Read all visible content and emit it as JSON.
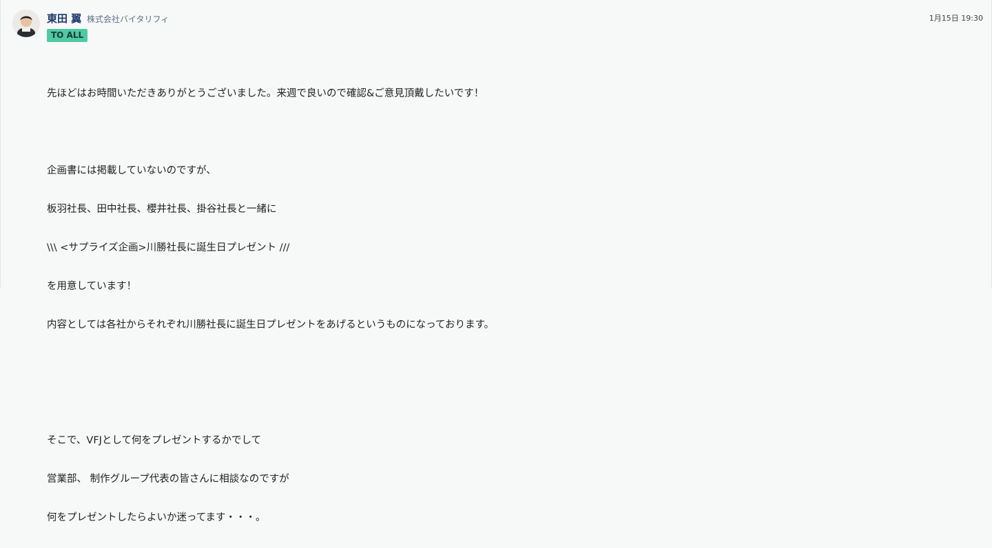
{
  "sender": {
    "name": "東田 翼",
    "organization": "株式会社バイタリフィ",
    "avatar": "user-avatar-photo"
  },
  "to_badge": "TO ALL",
  "timestamp": "1月15日 19:30",
  "body_lines": [
    "先ほどはお時間いただきありがとうございました。来週で良いので確認&ご意見頂戴したいです！",
    "",
    "企画書には掲載していないのですが、",
    "板羽社長、田中社長、櫻井社長、掛谷社長と一緒に",
    "\\\\\\ <サプライズ企画>川勝社長に誕生日プレゼント ///",
    "を用意しています！",
    "内容としては各社からそれぞれ川勝社長に誕生日プレゼントをあげるというものになっております。",
    "",
    "",
    "そこで、VFJとして何をプレゼントするかでして",
    "営業部、 制作グループ代表の皆さんに相談なのですが",
    "何をプレゼントしたらよいか迷ってます・・・。"
  ],
  "colors": {
    "badge": "#4ec9a4",
    "sender_name": "#1d3b6b",
    "background": "#f7f8f8"
  }
}
